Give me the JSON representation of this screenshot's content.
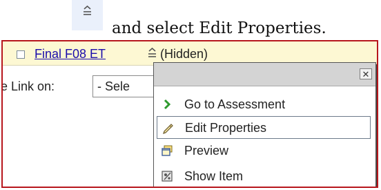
{
  "instruction": {
    "icon": "options-menu-icon",
    "text": "and select Edit Properties."
  },
  "item": {
    "title": "Final F08 ET",
    "status": "(Hidden)",
    "options_icon": "options-menu-icon"
  },
  "link_row": {
    "label": "e Link on:",
    "select_value": "- Sele"
  },
  "menu": {
    "close_label": "✕",
    "items": [
      {
        "label": "Go to Assessment",
        "icon": "green-chevron-icon"
      },
      {
        "label": "Edit Properties",
        "icon": "pencil-icon"
      },
      {
        "label": "Preview",
        "icon": "preview-window-icon"
      },
      {
        "label": "Show Item",
        "icon": "show-item-icon"
      }
    ]
  },
  "colors": {
    "frame_border": "#b7161c",
    "item_row_bg": "#fdf8d3",
    "link": "#1a0dab",
    "menu_header": "#d4d4d4"
  }
}
